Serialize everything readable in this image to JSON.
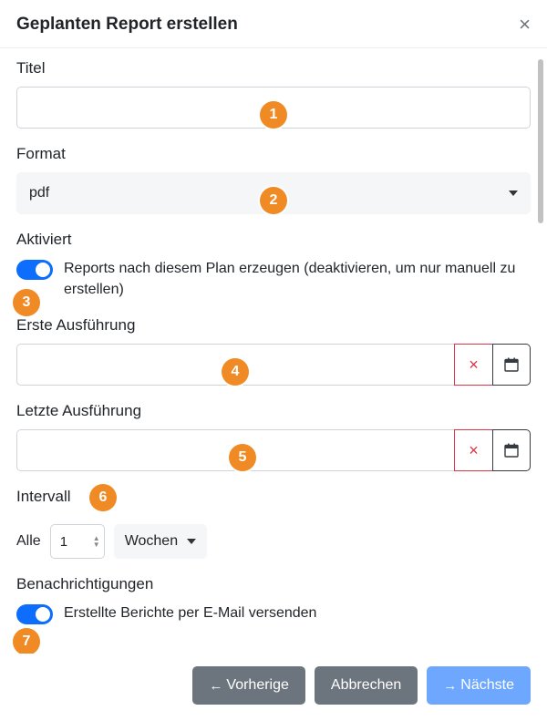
{
  "modal": {
    "title": "Geplanten Report erstellen",
    "close": "×"
  },
  "fields": {
    "title_label": "Titel",
    "title_value": "",
    "format_label": "Format",
    "format_value": "pdf",
    "activated_label": "Aktiviert",
    "activated_desc": "Reports nach diesem Plan erzeugen (deaktivieren, um nur manuell zu erstellen)",
    "first_run_label": "Erste Ausführung",
    "first_run_value": "",
    "last_run_label": "Letzte Ausführung",
    "last_run_value": "",
    "interval_label": "Intervall",
    "interval_prefix": "Alle",
    "interval_value": "1",
    "interval_unit": "Wochen",
    "notifications_label": "Benachrichtigungen",
    "notifications_desc": "Erstellte Berichte per E-Mail versenden"
  },
  "footer": {
    "prev": "Vorherige",
    "cancel": "Abbrechen",
    "next": "Nächste"
  },
  "badges": {
    "b1": "1",
    "b2": "2",
    "b3": "3",
    "b4": "4",
    "b5": "5",
    "b6": "6",
    "b7": "7"
  },
  "icons": {
    "clear": "×"
  }
}
